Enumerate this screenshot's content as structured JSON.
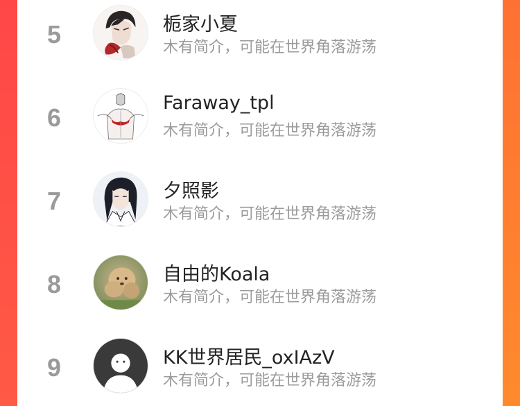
{
  "users": [
    {
      "rank": "5",
      "name": "栀家小夏",
      "bio": "木有简介，可能在世界角落游荡",
      "avatar_icon": "anime-man-avatar"
    },
    {
      "rank": "6",
      "name": "Faraway_tpl",
      "bio": "木有简介，可能在世界角落游荡",
      "avatar_icon": "sketch-back-avatar"
    },
    {
      "rank": "7",
      "name": "夕照影",
      "bio": "木有简介，可能在世界角落游荡",
      "avatar_icon": "anime-swordsman-avatar"
    },
    {
      "rank": "8",
      "name": "自由的Koala",
      "bio": "木有简介，可能在世界角落游荡",
      "avatar_icon": "poodle-dog-avatar"
    },
    {
      "rank": "9",
      "name": "KK世界居民_oxIAzV",
      "bio": "木有简介，可能在世界角落游荡",
      "avatar_icon": "default-user-avatar"
    }
  ],
  "colors": {
    "accent_left": "#ff4747",
    "accent_right": "#ff8a2c",
    "rank": "#9a9a9a",
    "name": "#222222",
    "bio": "#9b9b9b"
  }
}
